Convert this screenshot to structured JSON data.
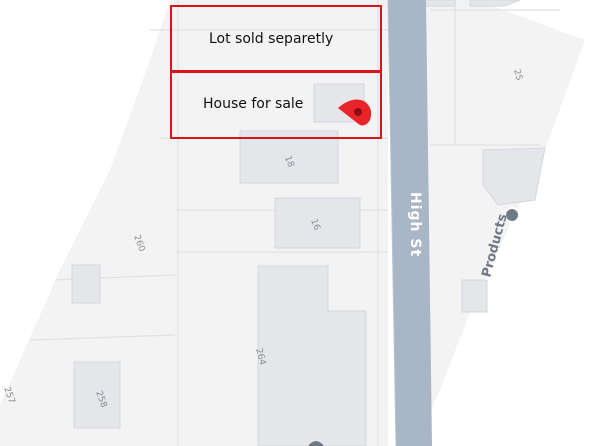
{
  "map": {
    "street_name": "High St",
    "business_label": "Products",
    "parcel_numbers": {
      "p25": "25",
      "p18": "18",
      "p16": "16",
      "p260": "260",
      "p264": "264",
      "p258": "258",
      "p257": "257"
    }
  },
  "annotations": {
    "lot_label": "Lot sold separetly",
    "house_label": "House for sale"
  },
  "colors": {
    "road": "#a9b6c6",
    "building": "#e4e6ea",
    "building_edge": "#d4d7dd",
    "land": "#f3f3f3",
    "parcel_line": "#e1e1e1",
    "highlight": "#d7141c",
    "marker": "#e8232a"
  }
}
